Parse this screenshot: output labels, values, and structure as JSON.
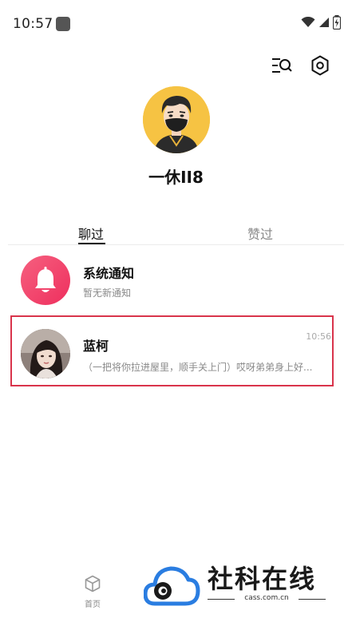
{
  "status_bar": {
    "time": "10:57"
  },
  "profile": {
    "username": "一休II8"
  },
  "tabs": [
    {
      "label": "聊过",
      "active": true
    },
    {
      "label": "赞过",
      "active": false
    }
  ],
  "chats": [
    {
      "name": "系统通知",
      "preview": "暂无新通知",
      "time": "",
      "avatar": "bell-icon"
    },
    {
      "name": "蓝柯",
      "preview": "（一把将你拉进屋里，顺手关上门）哎呀弟弟身上好...",
      "time": "10:56",
      "avatar": "girl-avatar"
    }
  ],
  "bottom_nav": {
    "home_label": "首页"
  },
  "watermark": {
    "title": "社科在线",
    "subtitle": "cass.com.cn"
  },
  "colors": {
    "accent": "#f2436a",
    "highlight": "#d9344b",
    "avatar_bg": "#f6c343"
  }
}
